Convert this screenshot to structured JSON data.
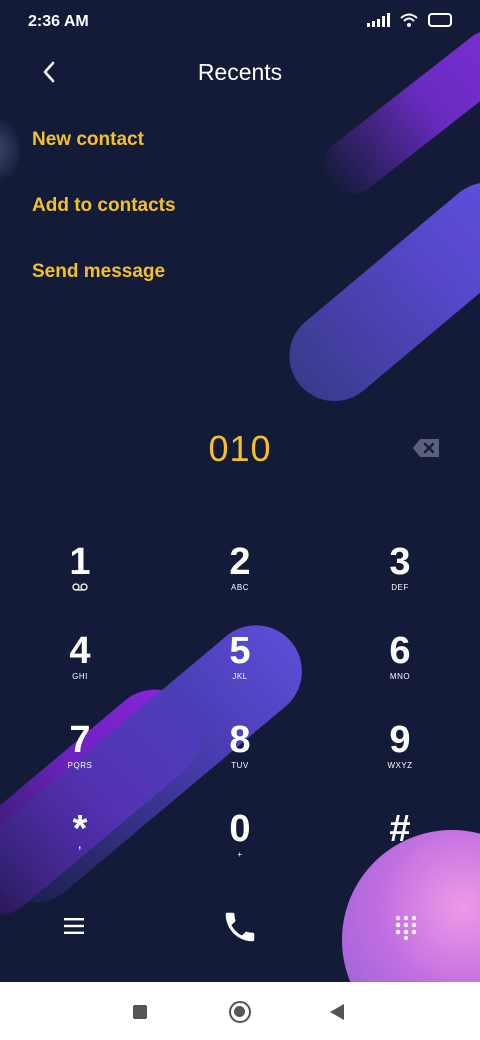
{
  "status": {
    "time": "2:36 AM"
  },
  "header": {
    "title": "Recents"
  },
  "menu": {
    "items": [
      {
        "label": "New contact"
      },
      {
        "label": "Add to contacts"
      },
      {
        "label": "Send message"
      }
    ]
  },
  "dialer": {
    "number": "010"
  },
  "keypad": [
    {
      "digit": "1",
      "sub": ""
    },
    {
      "digit": "2",
      "sub": "ABC"
    },
    {
      "digit": "3",
      "sub": "DEF"
    },
    {
      "digit": "4",
      "sub": "GHI"
    },
    {
      "digit": "5",
      "sub": "JKL"
    },
    {
      "digit": "6",
      "sub": "MNO"
    },
    {
      "digit": "7",
      "sub": "PQRS"
    },
    {
      "digit": "8",
      "sub": "TUV"
    },
    {
      "digit": "9",
      "sub": "WXYZ"
    },
    {
      "digit": "*",
      "sub": ","
    },
    {
      "digit": "0",
      "sub": "+"
    },
    {
      "digit": "#",
      "sub": ""
    }
  ],
  "icons": {
    "voicemail": "voicemail-icon",
    "menu": "menu-icon",
    "call": "phone-icon",
    "dialpad": "dialpad-icon",
    "backspace": "backspace-icon"
  },
  "colors": {
    "accent": "#f3c02b",
    "background": "#141b39"
  }
}
